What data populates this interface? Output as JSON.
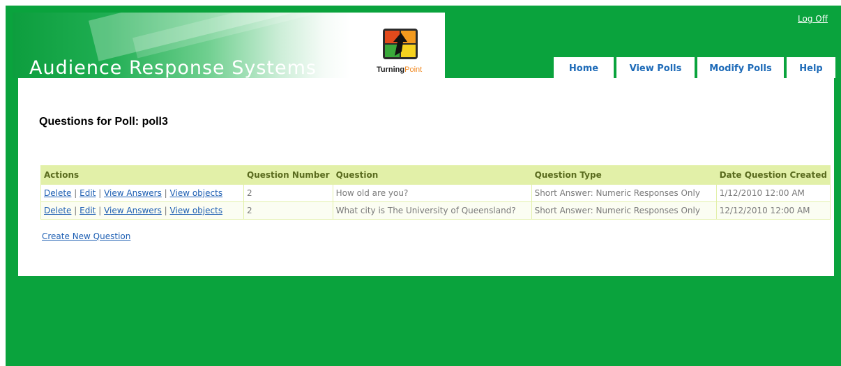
{
  "header": {
    "app_title": "Audience Response Systems",
    "logo_text_1": "Turning",
    "logo_text_2": "Point",
    "logoff_label": "Log Off"
  },
  "nav": [
    {
      "label": "Home"
    },
    {
      "label": "View Polls"
    },
    {
      "label": "Modify Polls"
    },
    {
      "label": "Help"
    }
  ],
  "main": {
    "page_title": "Questions for Poll: poll3",
    "create_link": "Create New Question",
    "table": {
      "columns": [
        "Actions",
        "Question Number",
        "Question",
        "Question Type",
        "Date Question Created"
      ],
      "action_labels": [
        "Delete",
        "Edit",
        "View Answers",
        "View objects"
      ],
      "separator": "|",
      "rows": [
        {
          "number": "2",
          "question": "How old are you?",
          "type": "Short Answer: Numeric Responses Only",
          "date": "1/12/2010 12:00 AM"
        },
        {
          "number": "2",
          "question": "What city is The University of Queensland?",
          "type": "Short Answer: Numeric Responses Only",
          "date": "12/12/2010 12:00 AM"
        }
      ]
    }
  },
  "colors": {
    "frame_green": "#0aa33d",
    "header_cell": "#e2f0a8",
    "link_blue": "#1e5fb3",
    "nav_text": "#1e6bb8"
  }
}
